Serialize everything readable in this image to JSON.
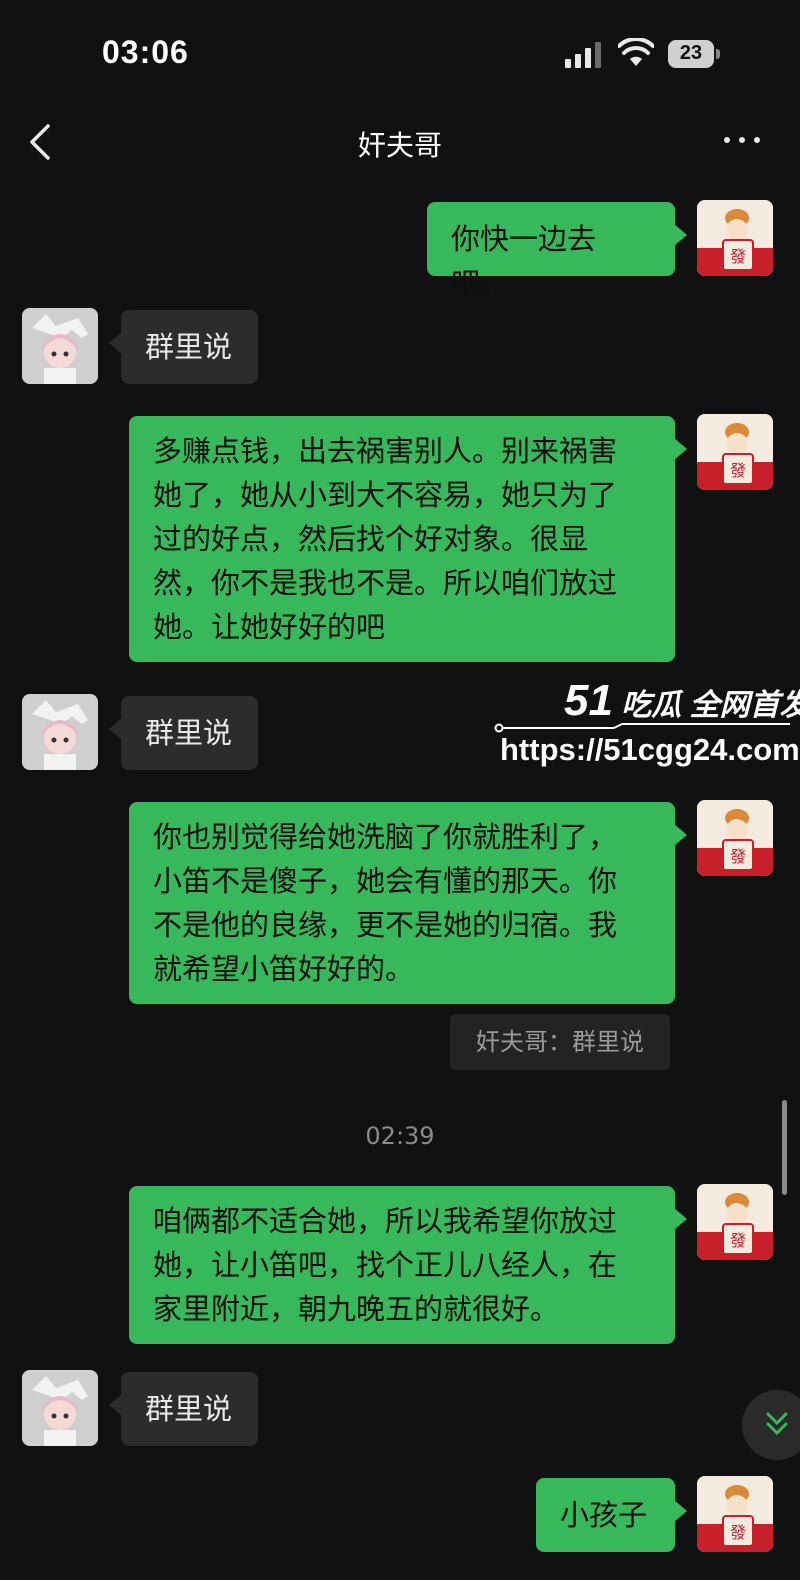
{
  "status": {
    "time": "03:06",
    "battery": "23"
  },
  "header": {
    "title": "奸夫哥"
  },
  "messages": [
    {
      "side": "out",
      "lines": [
        "你快一边去吧。"
      ]
    },
    {
      "side": "in",
      "lines": [
        "群里说"
      ]
    },
    {
      "side": "out",
      "lines": [
        "多赚点钱，出去祸害别人。别来祸害",
        "她了，她从小到大不容易，她只为了",
        "过的好点，然后找个好对象。很显",
        "然，你不是我也不是。所以咱们放过",
        "她。让她好好的吧"
      ]
    },
    {
      "side": "in",
      "lines": [
        "群里说"
      ]
    },
    {
      "side": "out",
      "lines": [
        "你也别觉得给她洗脑了你就胜利了，",
        "小笛不是傻子，她会有懂的那天。你",
        "不是他的良缘，更不是她的归宿。我",
        "就希望小笛好好的。"
      ]
    },
    {
      "quote": "奸夫哥：群里说"
    },
    {
      "timestamp": "02:39"
    },
    {
      "side": "out",
      "lines": [
        "咱俩都不适合她，所以我希望你放过",
        "她，让小笛吧，找个正儿八经人，在",
        "家里附近，朝九晚五的就很好。"
      ]
    },
    {
      "side": "in",
      "lines": [
        "群里说"
      ]
    },
    {
      "side": "out",
      "lines": [
        "小孩子"
      ]
    }
  ],
  "watermark": {
    "brand_num": "51",
    "brand_text": "吃瓜 全网首发",
    "url": "https://51cgg24.com"
  },
  "colors": {
    "outgoing_bubble": "#37b85b",
    "incoming_bubble": "#2c2c2c",
    "background": "#111111"
  },
  "icons": [
    "back-chevron-icon",
    "more-dots-icon",
    "signal-icon",
    "wifi-icon",
    "battery-icon",
    "scroll-down-icon",
    "user-avatar-fortune-icon",
    "contact-avatar-cartoon-icon"
  ]
}
